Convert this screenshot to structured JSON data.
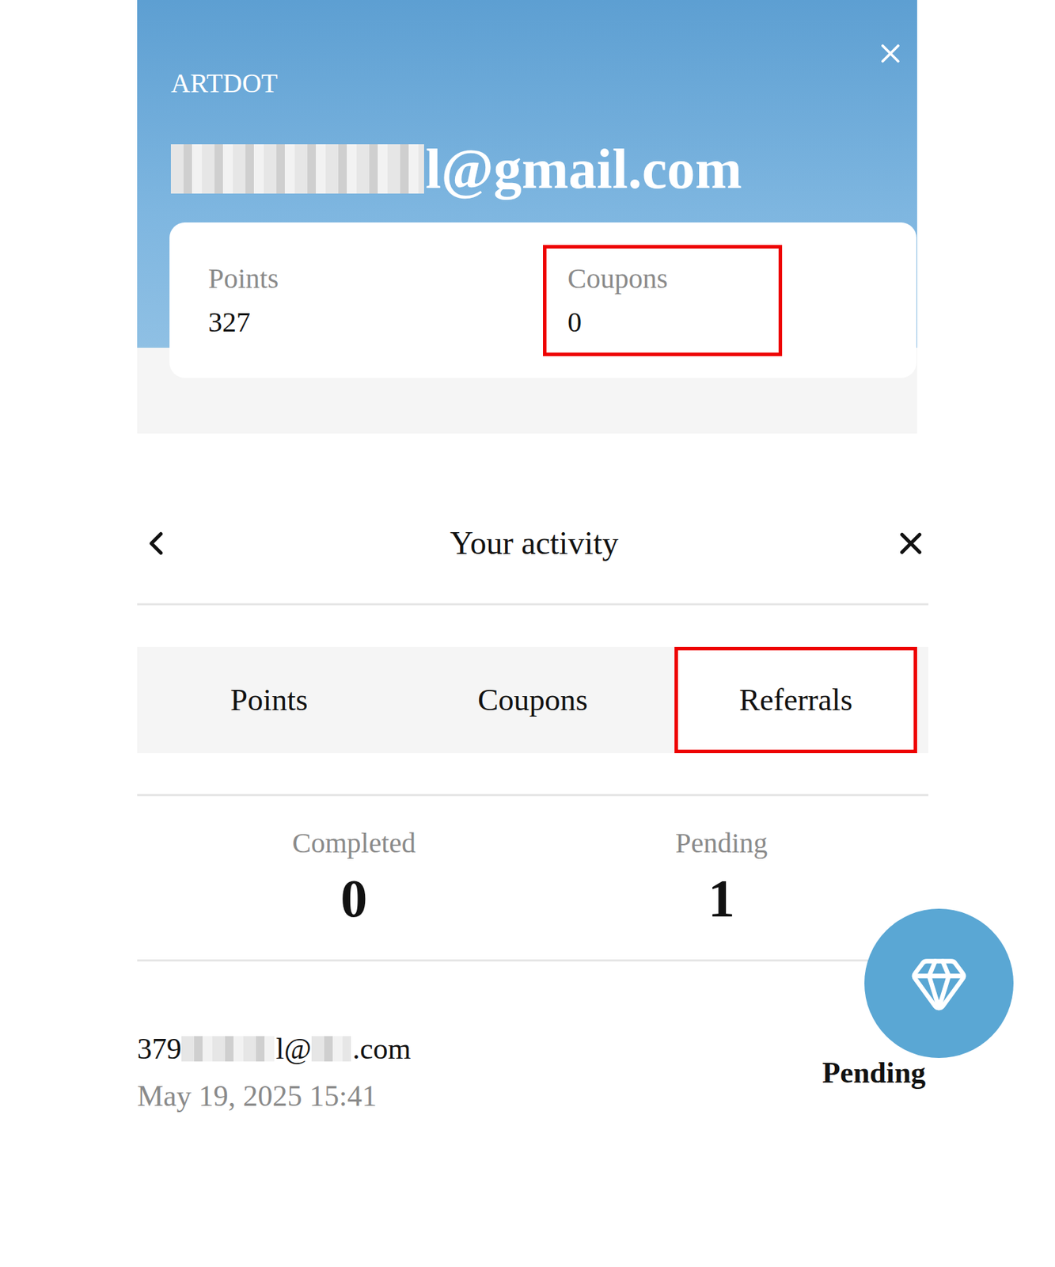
{
  "brand": "ARTDOT",
  "account": {
    "email_segments": [
      {
        "kind": "redacted",
        "text": "",
        "length": 10
      },
      {
        "kind": "text",
        "text": "l@gmail.com",
        "length": 11
      }
    ]
  },
  "summary": [
    {
      "label": "Points",
      "value": "327",
      "highlighted": false
    },
    {
      "label": "Coupons",
      "value": "0",
      "highlighted": true
    }
  ],
  "activity": {
    "title": "Your activity",
    "tabs": [
      {
        "label": "Points",
        "selected": false,
        "highlighted": false
      },
      {
        "label": "Coupons",
        "selected": false,
        "highlighted": false
      },
      {
        "label": "Referrals",
        "selected": true,
        "highlighted": true
      }
    ],
    "stats": [
      {
        "label": "Completed",
        "value": "0"
      },
      {
        "label": "Pending",
        "value": "1"
      }
    ],
    "referrals": [
      {
        "email_segments": [
          {
            "kind": "text",
            "text": "379",
            "length": 3
          },
          {
            "kind": "redacted",
            "text": "",
            "length": 7
          },
          {
            "kind": "text",
            "text": "l@",
            "length": 2
          },
          {
            "kind": "redacted",
            "text": "",
            "length": 3
          },
          {
            "kind": "text",
            "text": ".com",
            "length": 4
          }
        ],
        "date": "May 19, 2025 15:41",
        "status": "Pending"
      }
    ]
  }
}
